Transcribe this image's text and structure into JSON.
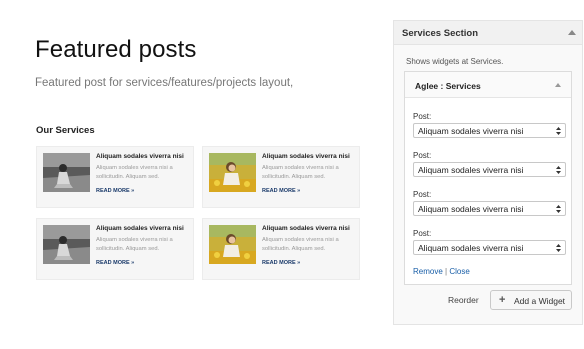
{
  "page": {
    "title": "Featured posts",
    "subtitle": "Featured post for services/features/projects layout,",
    "section_title": "Our Services"
  },
  "cards": [
    {
      "title": "Aliquam sodales viverra nisi",
      "excerpt": "Aliquam sodales viverra nisi a sollicitudin. Aliquam sed.",
      "more": "READ MORE",
      "photo": "grayscale"
    },
    {
      "title": "Aliquam sodales viverra nisi",
      "excerpt": "Aliquam sodales viverra nisi a sollicitudin. Aliquam sed.",
      "more": "READ MORE",
      "photo": "color"
    },
    {
      "title": "Aliquam sodales viverra nisi",
      "excerpt": "Aliquam sodales viverra nisi a sollicitudin. Aliquam sed.",
      "more": "READ MORE",
      "photo": "grayscale"
    },
    {
      "title": "Aliquam sodales viverra nisi",
      "excerpt": "Aliquam sodales viverra nisi a sollicitudin. Aliquam sed.",
      "more": "READ MORE",
      "photo": "color"
    }
  ],
  "panel": {
    "title": "Services Section",
    "description": "Shows widgets at Services.",
    "widget": {
      "title": "Aglee : Services",
      "fields": [
        {
          "label": "Post:",
          "value": "Aliquam sodales viverra nisi"
        },
        {
          "label": "Post:",
          "value": "Aliquam sodales viverra nisi"
        },
        {
          "label": "Post:",
          "value": "Aliquam sodales viverra nisi"
        },
        {
          "label": "Post:",
          "value": "Aliquam sodales viverra nisi"
        }
      ],
      "remove_label": "Remove",
      "separator": "|",
      "close_label": "Close"
    },
    "reorder_label": "Reorder",
    "add_widget_label": "Add a Widget"
  },
  "colors": {
    "link": "#1a5fa8",
    "read_more": "#1a3a6a"
  }
}
